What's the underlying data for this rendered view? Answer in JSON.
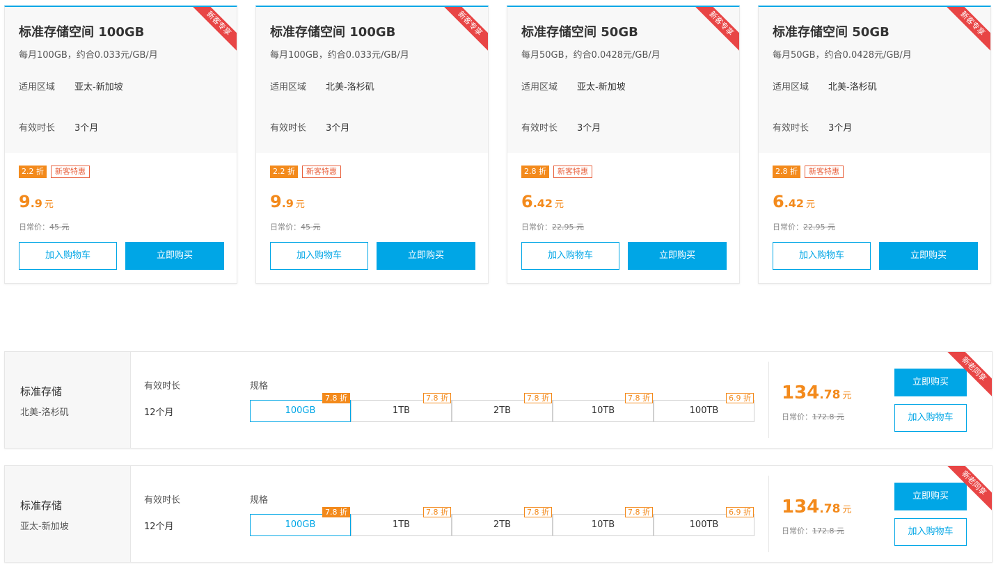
{
  "cards": [
    {
      "title": "标准存储空间 100GB",
      "desc": "每月100GB，约合0.033元/GB/月",
      "region_label": "适用区域",
      "region": "亚太-新加坡",
      "duration_label": "有效时长",
      "duration": "3个月",
      "ribbon": "新客专享",
      "discount": "2.2 折",
      "badge": "新客特惠",
      "price_int": "9",
      "price_dec": ".9",
      "price_unit": "元",
      "orig_label": "日常价：",
      "orig_price": "45 元",
      "cart_label": "加入购物车",
      "buy_label": "立即购买"
    },
    {
      "title": "标准存储空间 100GB",
      "desc": "每月100GB，约合0.033元/GB/月",
      "region_label": "适用区域",
      "region": "北美-洛杉矶",
      "duration_label": "有效时长",
      "duration": "3个月",
      "ribbon": "新客专享",
      "discount": "2.2 折",
      "badge": "新客特惠",
      "price_int": "9",
      "price_dec": ".9",
      "price_unit": "元",
      "orig_label": "日常价：",
      "orig_price": "45 元",
      "cart_label": "加入购物车",
      "buy_label": "立即购买"
    },
    {
      "title": "标准存储空间 50GB",
      "desc": "每月50GB，约合0.0428元/GB/月",
      "region_label": "适用区域",
      "region": "亚太-新加坡",
      "duration_label": "有效时长",
      "duration": "3个月",
      "ribbon": "新客专享",
      "discount": "2.8 折",
      "badge": "新客特惠",
      "price_int": "6",
      "price_dec": ".42",
      "price_unit": "元",
      "orig_label": "日常价：",
      "orig_price": "22.95 元",
      "cart_label": "加入购物车",
      "buy_label": "立即购买"
    },
    {
      "title": "标准存储空间 50GB",
      "desc": "每月50GB，约合0.0428元/GB/月",
      "region_label": "适用区域",
      "region": "北美-洛杉矶",
      "duration_label": "有效时长",
      "duration": "3个月",
      "ribbon": "新客专享",
      "discount": "2.8 折",
      "badge": "新客特惠",
      "price_int": "6",
      "price_dec": ".42",
      "price_unit": "元",
      "orig_label": "日常价：",
      "orig_price": "22.95 元",
      "cart_label": "加入购物车",
      "buy_label": "立即购买"
    }
  ],
  "offers": [
    {
      "name": "标准存储",
      "region": "北美-洛杉矶",
      "duration_label": "有效时长",
      "duration": "12个月",
      "spec_label": "规格",
      "specs": [
        {
          "label": "100GB",
          "discount": "7.8 折",
          "selected": true
        },
        {
          "label": "1TB",
          "discount": "7.8 折",
          "selected": false
        },
        {
          "label": "2TB",
          "discount": "7.8 折",
          "selected": false
        },
        {
          "label": "10TB",
          "discount": "7.8 折",
          "selected": false
        },
        {
          "label": "100TB",
          "discount": "6.9 折",
          "selected": false
        }
      ],
      "price_int": "134",
      "price_dec": ".78",
      "price_unit": "元",
      "orig_label": "日常价：",
      "orig_price": "172.8 元",
      "buy_label": "立即购买",
      "cart_label": "加入购物车",
      "ribbon": "新老同享"
    },
    {
      "name": "标准存储",
      "region": "亚太-新加坡",
      "duration_label": "有效时长",
      "duration": "12个月",
      "spec_label": "规格",
      "specs": [
        {
          "label": "100GB",
          "discount": "7.8 折",
          "selected": true
        },
        {
          "label": "1TB",
          "discount": "7.8 折",
          "selected": false
        },
        {
          "label": "2TB",
          "discount": "7.8 折",
          "selected": false
        },
        {
          "label": "10TB",
          "discount": "7.8 折",
          "selected": false
        },
        {
          "label": "100TB",
          "discount": "6.9 折",
          "selected": false
        }
      ],
      "price_int": "134",
      "price_dec": ".78",
      "price_unit": "元",
      "orig_label": "日常价：",
      "orig_price": "172.8 元",
      "buy_label": "立即购买",
      "cart_label": "加入购物车",
      "ribbon": "新老同享"
    }
  ],
  "colors": {
    "accent": "#00a6e6",
    "price": "#f38a1c",
    "ribbon": "#e84545",
    "badge": "#e8603c"
  }
}
